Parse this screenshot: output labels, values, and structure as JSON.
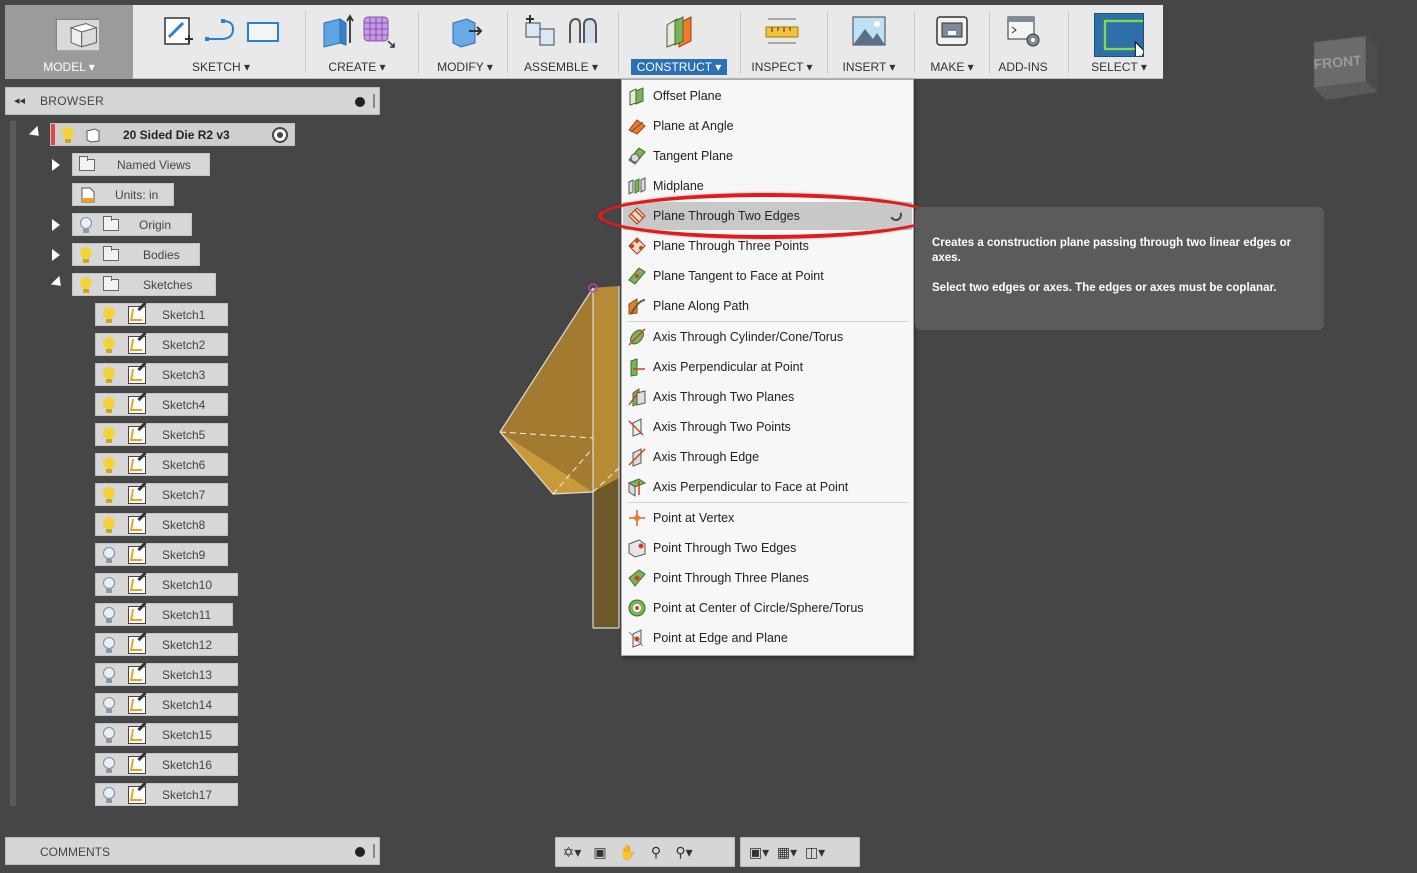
{
  "toolbar": {
    "groups": [
      {
        "label": "MODEL ▾"
      },
      {
        "label": "SKETCH ▾"
      },
      {
        "label": "CREATE ▾"
      },
      {
        "label": "MODIFY ▾"
      },
      {
        "label": "ASSEMBLE ▾"
      },
      {
        "label": "CONSTRUCT ▾"
      },
      {
        "label": "INSPECT ▾"
      },
      {
        "label": "INSERT ▾"
      },
      {
        "label": "MAKE ▾"
      },
      {
        "label": "ADD-INS"
      },
      {
        "label": "SELECT ▾"
      }
    ]
  },
  "browser": {
    "title": "BROWSER",
    "collapse_glyph": "◂◂",
    "root": "20 Sided Die R2 v3",
    "folders": {
      "named_views": "Named Views",
      "units": "Units: in",
      "origin": "Origin",
      "bodies": "Bodies",
      "sketches": "Sketches"
    },
    "sketches": [
      "Sketch1",
      "Sketch2",
      "Sketch3",
      "Sketch4",
      "Sketch5",
      "Sketch6",
      "Sketch7",
      "Sketch8",
      "Sketch9",
      "Sketch10",
      "Sketch11",
      "Sketch12",
      "Sketch13",
      "Sketch14",
      "Sketch15",
      "Sketch16",
      "Sketch17"
    ]
  },
  "comments": {
    "title": "COMMENTS"
  },
  "viewcube": {
    "face": "FRONT"
  },
  "construct_menu": {
    "items": [
      {
        "label": "Offset Plane",
        "icon": "offset-plane-icon"
      },
      {
        "label": "Plane at Angle",
        "icon": "plane-at-angle-icon"
      },
      {
        "label": "Tangent Plane",
        "icon": "tangent-plane-icon"
      },
      {
        "label": "Midplane",
        "icon": "midplane-icon"
      },
      {
        "label": "Plane Through Two Edges",
        "icon": "plane-two-edges-icon"
      },
      {
        "label": "Plane Through Three Points",
        "icon": "plane-three-points-icon"
      },
      {
        "label": "Plane Tangent to Face at Point",
        "icon": "plane-tangent-face-icon"
      },
      {
        "label": "Plane Along Path",
        "icon": "plane-along-path-icon"
      },
      {
        "label": "Axis Through Cylinder/Cone/Torus",
        "icon": "axis-cylinder-icon"
      },
      {
        "label": "Axis Perpendicular at Point",
        "icon": "axis-perp-point-icon"
      },
      {
        "label": "Axis Through Two Planes",
        "icon": "axis-two-planes-icon"
      },
      {
        "label": "Axis Through Two Points",
        "icon": "axis-two-points-icon"
      },
      {
        "label": "Axis Through Edge",
        "icon": "axis-edge-icon"
      },
      {
        "label": "Axis Perpendicular to Face at Point",
        "icon": "axis-perp-face-icon"
      },
      {
        "label": "Point at Vertex",
        "icon": "point-vertex-icon"
      },
      {
        "label": "Point Through Two Edges",
        "icon": "point-two-edges-icon"
      },
      {
        "label": "Point Through Three Planes",
        "icon": "point-three-planes-icon"
      },
      {
        "label": "Point at Center of Circle/Sphere/Torus",
        "icon": "point-center-icon"
      },
      {
        "label": "Point at Edge and Plane",
        "icon": "point-edge-plane-icon"
      }
    ]
  },
  "tooltip": {
    "line1": "Creates a construction plane passing through two linear edges or axes.",
    "line2": "Select two edges or axes. The edges or axes must be coplanar."
  },
  "colors": {
    "background": "#464646",
    "toolbar": "#e9e9e9",
    "active_tab": "#2b6fb6",
    "highlight_ring": "#e01b1b",
    "model_fill": "#c99a3a"
  }
}
